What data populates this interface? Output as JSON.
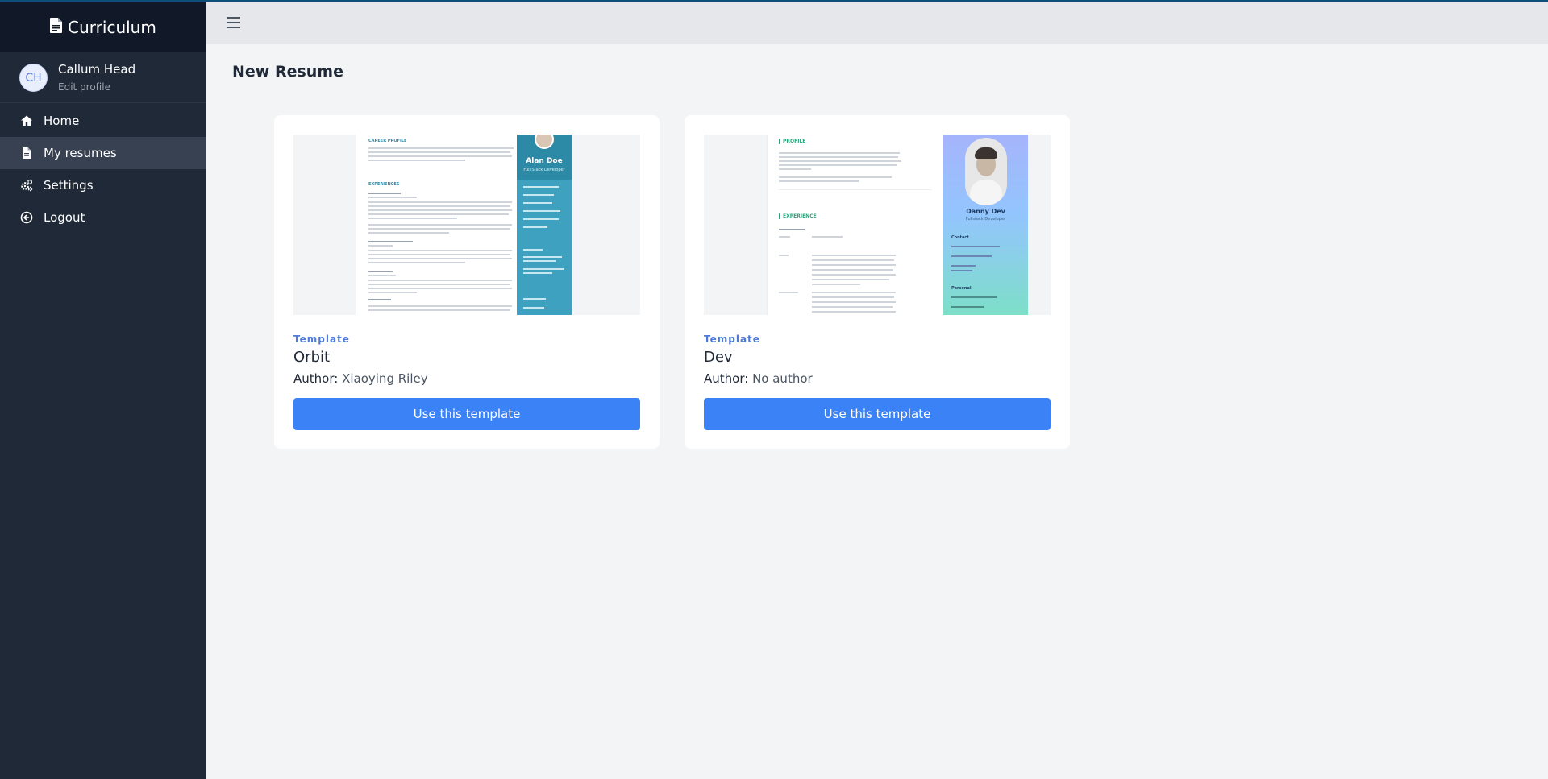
{
  "app": {
    "brand": "Curriculum",
    "brand_icon": "document-icon"
  },
  "user": {
    "initials": "CH",
    "name": "Callum Head",
    "edit_label": "Edit profile"
  },
  "sidebar": {
    "items": [
      {
        "label": "Home",
        "icon": "home-icon",
        "active": false
      },
      {
        "label": "My resumes",
        "icon": "file-icon",
        "active": true
      },
      {
        "label": "Settings",
        "icon": "gears-icon",
        "active": false
      },
      {
        "label": "Logout",
        "icon": "logout-icon",
        "active": false
      }
    ]
  },
  "topbar": {
    "menu_icon": "hamburger-icon"
  },
  "main": {
    "title": "New Resume",
    "cards": [
      {
        "label": "Template",
        "name": "Orbit",
        "author_label": "Author:",
        "author": "Xiaoying Riley",
        "button": "Use this template",
        "preview": {
          "headings": [
            "CAREER PROFILE",
            "EXPERIENCES"
          ],
          "person": "Alan Doe",
          "role": "Full Stack Developer"
        }
      },
      {
        "label": "Template",
        "name": "Dev",
        "author_label": "Author:",
        "author": "No author",
        "button": "Use this template",
        "preview": {
          "headings": [
            "PROFILE",
            "EXPERIENCE"
          ],
          "person": "Danny Dev",
          "role": "Fullstack Developer",
          "side_headings": [
            "Contact",
            "Personal"
          ]
        }
      }
    ]
  },
  "colors": {
    "sidebar_bg": "#1f2937",
    "brand_bg": "#111827",
    "active_item": "#374151",
    "primary_button": "#3b82f6",
    "template_label": "#4f7ad9"
  }
}
